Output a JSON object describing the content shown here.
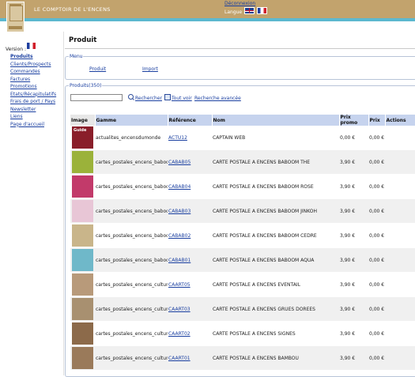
{
  "header": {
    "site_title": "LE COMPTOIR DE L'ENCENS",
    "logout": "Déconnexion",
    "language_label": "Langue :"
  },
  "sidebar": {
    "version_label": "Version :",
    "items": [
      {
        "label": "Produits"
      },
      {
        "label": "Clients/Prospects"
      },
      {
        "label": "Commandes"
      },
      {
        "label": "Factures"
      },
      {
        "label": "Promotions"
      },
      {
        "label": "Etats/Récapitulatifs"
      },
      {
        "label": "Frais de port / Pays"
      },
      {
        "label": "Newsletter"
      },
      {
        "label": "Liens"
      },
      {
        "label": "Page d'accueil"
      }
    ]
  },
  "main": {
    "title": "Produit",
    "menu": {
      "legend": "Menu",
      "produit": "Produit",
      "import": "Import"
    },
    "products": {
      "legend": "Produits(350)",
      "search_button": "Rechercher",
      "view_all": "Tout voir",
      "advanced_search": "Recherche avancée",
      "columns": [
        "Image",
        "Gamme",
        "Référence",
        "Nom",
        "Prix promo",
        "Prix",
        "Actions"
      ],
      "rows": [
        {
          "gamme": "actualites_encensdumonde",
          "ref": "ACTU12",
          "nom": "CAPTAIN WEB",
          "promo": "0,00 €",
          "prix": "0,00 €",
          "thumb_color": "#8a1e2a",
          "thumb_label": "Guide"
        },
        {
          "gamme": "cartes_postales_encens_baboom",
          "ref": "CABAB05",
          "nom": "CARTE POSTALE A ENCENS BABOOM THE",
          "promo": "3,90 €",
          "prix": "0,00 €",
          "thumb_color": "#9bb23a",
          "thumb_label": ""
        },
        {
          "gamme": "cartes_postales_encens_baboom",
          "ref": "CABAB04",
          "nom": "CARTE POSTALE A ENCENS BABOOM ROSE",
          "promo": "3,90 €",
          "prix": "0,00 €",
          "thumb_color": "#c23a6a",
          "thumb_label": ""
        },
        {
          "gamme": "cartes_postales_encens_baboom",
          "ref": "CABAB03",
          "nom": "CARTE POSTALE A ENCENS BABOOM JINKOH",
          "promo": "3,90 €",
          "prix": "0,00 €",
          "thumb_color": "#e8c6d6",
          "thumb_label": ""
        },
        {
          "gamme": "cartes_postales_encens_baboom",
          "ref": "CABAB02",
          "nom": "CARTE POSTALE A ENCENS BABOOM CEDRE",
          "promo": "3,90 €",
          "prix": "0,00 €",
          "thumb_color": "#c9b58a",
          "thumb_label": ""
        },
        {
          "gamme": "cartes_postales_encens_baboom",
          "ref": "CABAB01",
          "nom": "CARTE POSTALE A ENCENS BABOOM AQUA",
          "promo": "3,90 €",
          "prix": "0,00 €",
          "thumb_color": "#6fb8c9",
          "thumb_label": ""
        },
        {
          "gamme": "cartes_postales_encens_culture",
          "ref": "CAART05",
          "nom": "CARTE POSTALE A ENCENS EVENTAIL",
          "promo": "3,90 €",
          "prix": "0,00 €",
          "thumb_color": "#b89a7a",
          "thumb_label": ""
        },
        {
          "gamme": "cartes_postales_encens_culture",
          "ref": "CAART03",
          "nom": "CARTE POSTALE A ENCENS GRUES DOREES",
          "promo": "3,90 €",
          "prix": "0,00 €",
          "thumb_color": "#a89070",
          "thumb_label": ""
        },
        {
          "gamme": "cartes_postales_encens_culture",
          "ref": "CAART02",
          "nom": "CARTE POSTALE A ENCENS SIGNES",
          "promo": "3,90 €",
          "prix": "0,00 €",
          "thumb_color": "#8c6a4a",
          "thumb_label": ""
        },
        {
          "gamme": "cartes_postales_encens_culture",
          "ref": "CAART01",
          "nom": "CARTE POSTALE A ENCENS BAMBOU",
          "promo": "3,90 €",
          "prix": "0,00 €",
          "thumb_color": "#9a7a5a",
          "thumb_label": ""
        }
      ]
    }
  },
  "colors": {
    "header": "#c2a36d",
    "header_stripe": "#5cb8cf",
    "table_header": "#c6d3ee",
    "link": "#1a3fa0"
  }
}
